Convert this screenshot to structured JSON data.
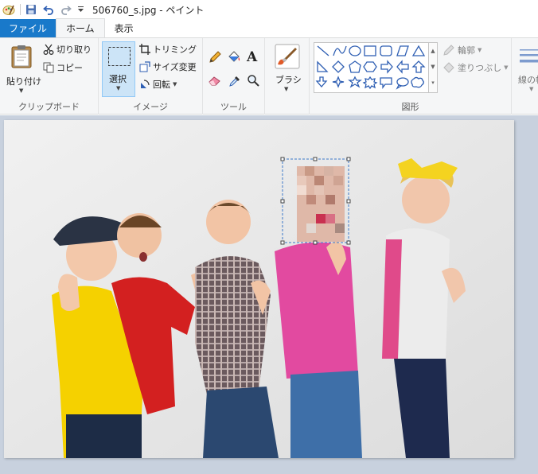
{
  "window": {
    "title": "506760_s.jpg - ペイント"
  },
  "quick_access": {
    "icons": [
      "paint-app-icon",
      "save-icon",
      "undo-icon",
      "redo-icon",
      "customize-dropdown-icon"
    ]
  },
  "tabs": [
    {
      "label": "ファイル"
    },
    {
      "label": "ホーム"
    },
    {
      "label": "表示"
    }
  ],
  "ribbon": {
    "clipboard": {
      "paste_label": "貼り付け",
      "cut_label": "切り取り",
      "copy_label": "コピー",
      "group_label": "クリップボード"
    },
    "image": {
      "select_label": "選択",
      "crop_label": "トリミング",
      "resize_label": "サイズ変更",
      "rotate_label": "回転",
      "group_label": "イメージ"
    },
    "tools": {
      "group_label": "ツール"
    },
    "brush": {
      "label": "ブラシ"
    },
    "shapes": {
      "outline_label": "輪郭",
      "fill_label": "塗りつぶし",
      "group_label": "図形"
    },
    "size": {
      "label": "線の幅"
    }
  },
  "colors": {
    "accent": "#1979ca",
    "ribbon_bg": "#f5f6f7",
    "canvas_bg": "#c8d1de",
    "selection": "#3a78c9"
  }
}
